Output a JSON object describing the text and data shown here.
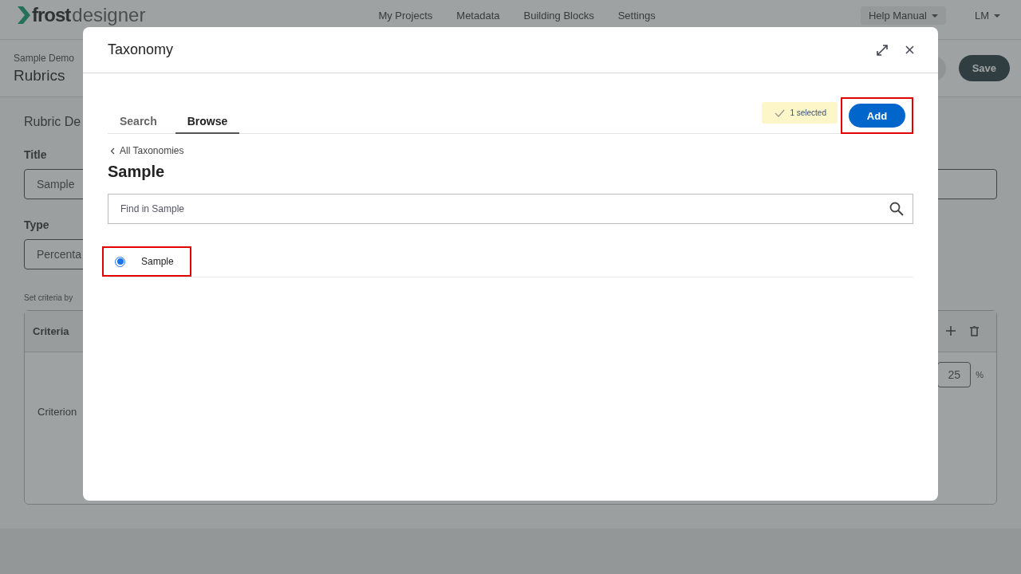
{
  "header": {
    "logo_bold": "frost",
    "logo_light": "designer",
    "nav": [
      "My Projects",
      "Metadata",
      "Building Blocks",
      "Settings"
    ],
    "help": "Help Manual",
    "user": "LM"
  },
  "page": {
    "breadcrumb": "Sample Demo",
    "title": "Rubrics",
    "save": "Save",
    "section_title": "Rubric De",
    "fields": [
      {
        "label": "Title",
        "value": "Sample"
      },
      {
        "label": "Type",
        "value": "Percenta"
      }
    ],
    "hint": "Set criteria by",
    "table": {
      "header": "Criteria",
      "row_label": "Criterion",
      "weight": "25",
      "unit": "%"
    }
  },
  "dialog": {
    "title": "Taxonomy",
    "tabs": [
      {
        "label": "Search",
        "selected": false
      },
      {
        "label": "Browse",
        "selected": true
      }
    ],
    "selection_count": "1 selected",
    "add": {
      "label": "Add",
      "highlighted": true
    },
    "back": "All Taxonomies",
    "heading": "Sample",
    "search": {
      "placeholder": "Find in Sample"
    },
    "options": [
      {
        "label": "Sample",
        "selected": true,
        "highlighted": true
      }
    ]
  }
}
